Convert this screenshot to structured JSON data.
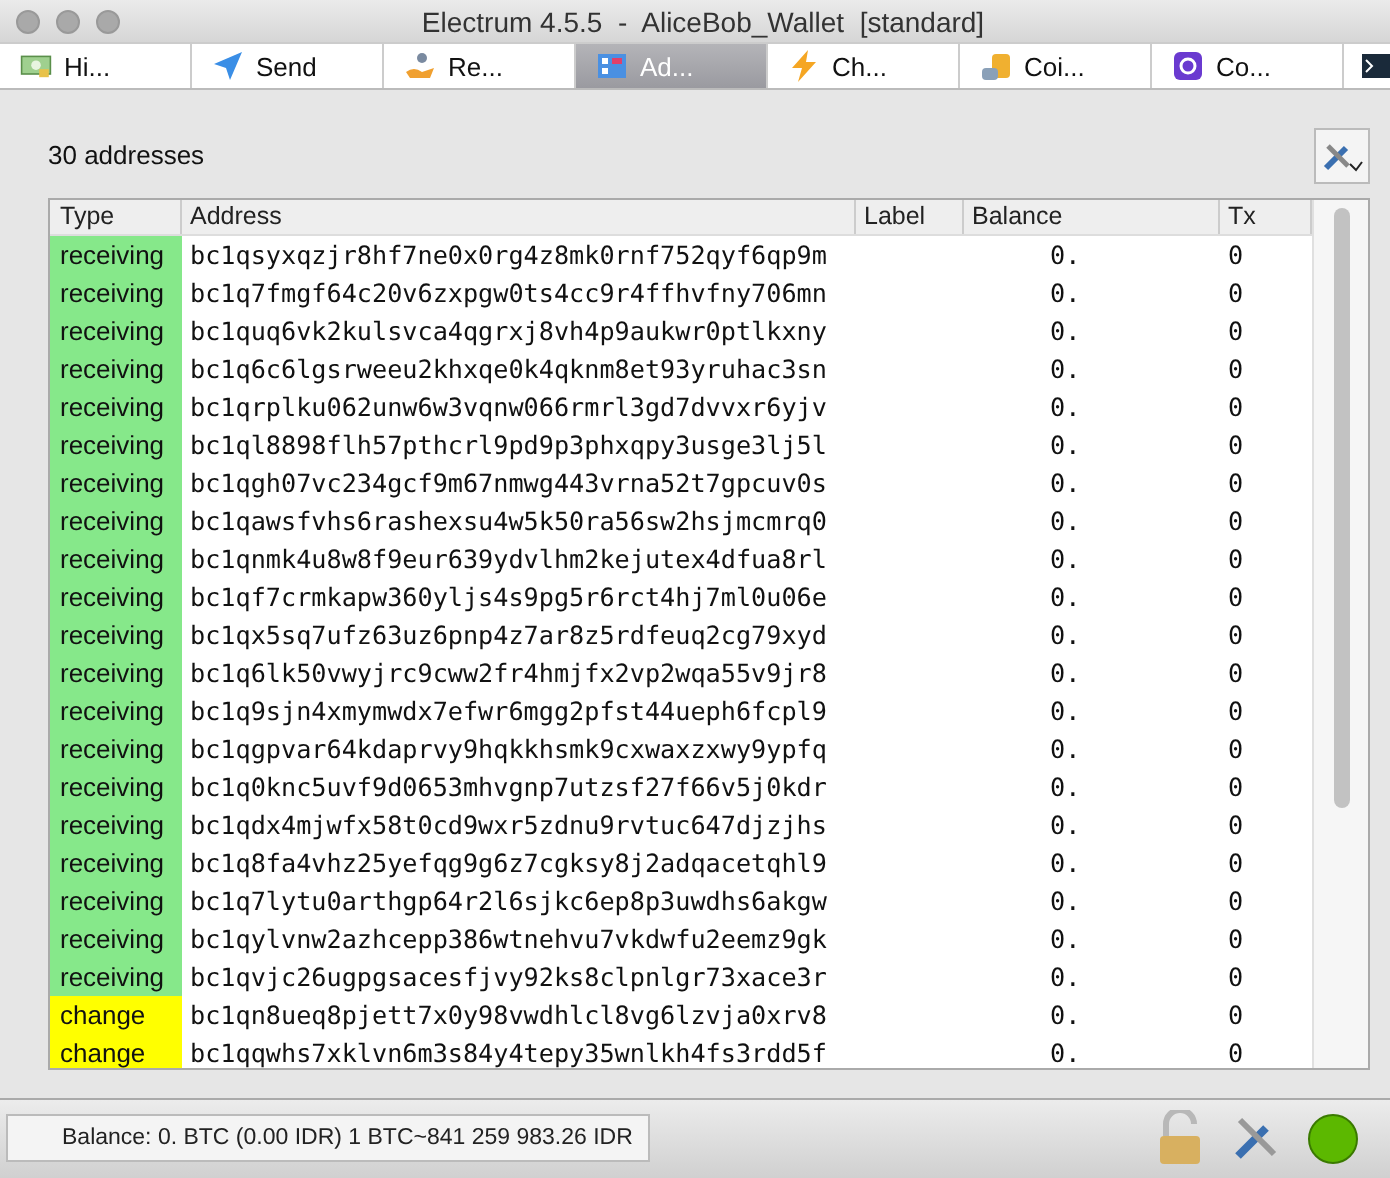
{
  "window": {
    "title": "Electrum 4.5.5  -  AliceBob_Wallet  [standard]"
  },
  "tabs": [
    {
      "label": "Hi...",
      "kind": "history",
      "selected": false
    },
    {
      "label": "Send",
      "kind": "send",
      "selected": false
    },
    {
      "label": "Re...",
      "kind": "receive",
      "selected": false
    },
    {
      "label": "Ad...",
      "kind": "addresses",
      "selected": true
    },
    {
      "label": "Ch...",
      "kind": "channels",
      "selected": false
    },
    {
      "label": "Coi...",
      "kind": "coins",
      "selected": false
    },
    {
      "label": "Co...",
      "kind": "contacts",
      "selected": false
    },
    {
      "kind": "console",
      "selected": false
    }
  ],
  "count": "30 addresses",
  "table": {
    "columns": [
      "Type",
      "Address",
      "Label",
      "Balance",
      "Tx"
    ],
    "rows": [
      {
        "type": "receiving",
        "color": "#86e88a",
        "address": "bc1qsyxqzjr8hf7ne0x0rg4z8mk0rnf752qyf6qp9m",
        "balance": "0.",
        "tx": "0"
      },
      {
        "type": "receiving",
        "color": "#86e88a",
        "address": "bc1q7fmgf64c20v6zxpgw0ts4cc9r4ffhvfny706mn",
        "balance": "0.",
        "tx": "0"
      },
      {
        "type": "receiving",
        "color": "#86e88a",
        "address": "bc1quq6vk2kulsvca4qgrxj8vh4p9aukwr0ptlkxny",
        "balance": "0.",
        "tx": "0"
      },
      {
        "type": "receiving",
        "color": "#86e88a",
        "address": "bc1q6c6lgsrweeu2khxqe0k4qknm8et93yruhac3sn",
        "balance": "0.",
        "tx": "0"
      },
      {
        "type": "receiving",
        "color": "#86e88a",
        "address": "bc1qrplku062unw6w3vqnw066rmrl3gd7dvvxr6yjv",
        "balance": "0.",
        "tx": "0"
      },
      {
        "type": "receiving",
        "color": "#86e88a",
        "address": "bc1ql8898flh57pthcrl9pd9p3phxqpy3usge3lj5l",
        "balance": "0.",
        "tx": "0"
      },
      {
        "type": "receiving",
        "color": "#86e88a",
        "address": "bc1qgh07vc234gcf9m67nmwg443vrna52t7gpcuv0s",
        "balance": "0.",
        "tx": "0"
      },
      {
        "type": "receiving",
        "color": "#86e88a",
        "address": "bc1qawsfvhs6rashexsu4w5k50ra56sw2hsjmcmrq0",
        "balance": "0.",
        "tx": "0"
      },
      {
        "type": "receiving",
        "color": "#86e88a",
        "address": "bc1qnmk4u8w8f9eur639ydvlhm2kejutex4dfua8rl",
        "balance": "0.",
        "tx": "0"
      },
      {
        "type": "receiving",
        "color": "#86e88a",
        "address": "bc1qf7crmkapw360yljs4s9pg5r6rct4hj7ml0u06e",
        "balance": "0.",
        "tx": "0"
      },
      {
        "type": "receiving",
        "color": "#86e88a",
        "address": "bc1qx5sq7ufz63uz6pnp4z7ar8z5rdfeuq2cg79xyd",
        "balance": "0.",
        "tx": "0"
      },
      {
        "type": "receiving",
        "color": "#86e88a",
        "address": "bc1q6lk50vwyjrc9cww2fr4hmjfx2vp2wqa55v9jr8",
        "balance": "0.",
        "tx": "0"
      },
      {
        "type": "receiving",
        "color": "#86e88a",
        "address": "bc1q9sjn4xmymwdx7efwr6mgg2pfst44ueph6fcpl9",
        "balance": "0.",
        "tx": "0"
      },
      {
        "type": "receiving",
        "color": "#86e88a",
        "address": "bc1qgpvar64kdaprvy9hqkkhsmk9cxwaxzxwy9ypfq",
        "balance": "0.",
        "tx": "0"
      },
      {
        "type": "receiving",
        "color": "#86e88a",
        "address": "bc1q0knc5uvf9d0653mhvgnp7utzsf27f66v5j0kdr",
        "balance": "0.",
        "tx": "0"
      },
      {
        "type": "receiving",
        "color": "#86e88a",
        "address": "bc1qdx4mjwfx58t0cd9wxr5zdnu9rvtuc647djzjhs",
        "balance": "0.",
        "tx": "0"
      },
      {
        "type": "receiving",
        "color": "#86e88a",
        "address": "bc1q8fa4vhz25yefqg9g6z7cgksy8j2adqacetqhl9",
        "balance": "0.",
        "tx": "0"
      },
      {
        "type": "receiving",
        "color": "#86e88a",
        "address": "bc1q7lytu0arthgp64r2l6sjkc6ep8p3uwdhs6akgw",
        "balance": "0.",
        "tx": "0"
      },
      {
        "type": "receiving",
        "color": "#86e88a",
        "address": "bc1qylvnw2azhcepp386wtnehvu7vkdwfu2eemz9gk",
        "balance": "0.",
        "tx": "0"
      },
      {
        "type": "receiving",
        "color": "#86e88a",
        "address": "bc1qvjc26ugpgsacesfjvy92ks8clpnlgr73xace3r",
        "balance": "0.",
        "tx": "0"
      },
      {
        "type": "change",
        "color": "#ffff00",
        "address": "bc1qn8ueq8pjett7x0y98vwdhlcl8vg6lzvja0xrv8",
        "balance": "0.",
        "tx": "0"
      },
      {
        "type": "change",
        "color": "#ffff00",
        "address": "bc1qqwhs7xklvn6m3s84y4tepy35wnlkh4fs3rdd5f",
        "balance": "0.",
        "tx": "0"
      }
    ]
  },
  "status_bar": {
    "balance": "Balance: 0. BTC (0.00 IDR)  1 BTC~841 259 983.26 IDR",
    "connected": true
  }
}
